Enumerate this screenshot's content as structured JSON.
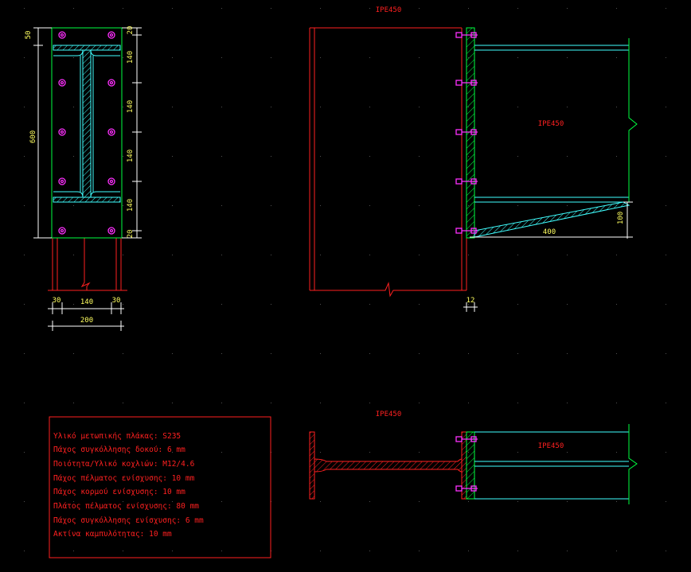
{
  "profiles": {
    "column_elevation_label": "IPE450",
    "beam_elevation_label": "IPE450",
    "column_plan_label": "IPE450",
    "beam_plan_label": "IPE450"
  },
  "dimensions": {
    "plate_height": "600",
    "plate_top_edge": "50",
    "bolt_edge_top": "20",
    "bolt_pitch_1": "140",
    "bolt_pitch_2": "140",
    "bolt_pitch_3": "140",
    "bolt_pitch_4": "140",
    "bolt_edge_bottom": "20",
    "edge_left": "30",
    "gauge": "140",
    "edge_right": "30",
    "plate_width": "200",
    "plate_thickness": "12",
    "haunch_length": "400",
    "haunch_depth": "100"
  },
  "notes": [
    "Υλικό μετωπικής πλάκας: S235",
    "Πάχος συγκόλλησης δοκού: 6 mm",
    "Ποιότητα/Υλικό κοχλιών: M12/4.6",
    "Πάχος πέλματος ενίσχυσης: 10 mm",
    "Πάχος κορμού ενίσχυσης: 10 mm",
    "Πλάτος πέλματος ενίσχυσης: 80 mm",
    "Πάχος συγκόλλησης ενίσχυσης: 6 mm",
    "Ακτίνα καμπυλότητας: 10 mm"
  ],
  "colors": {
    "background": "#000000",
    "steel": "#ff2020",
    "plate": "#00ff40",
    "beam": "#40ffff",
    "bolt": "#ff30ff",
    "dimension": "#ffffff",
    "dimension_text": "#ffff60"
  }
}
